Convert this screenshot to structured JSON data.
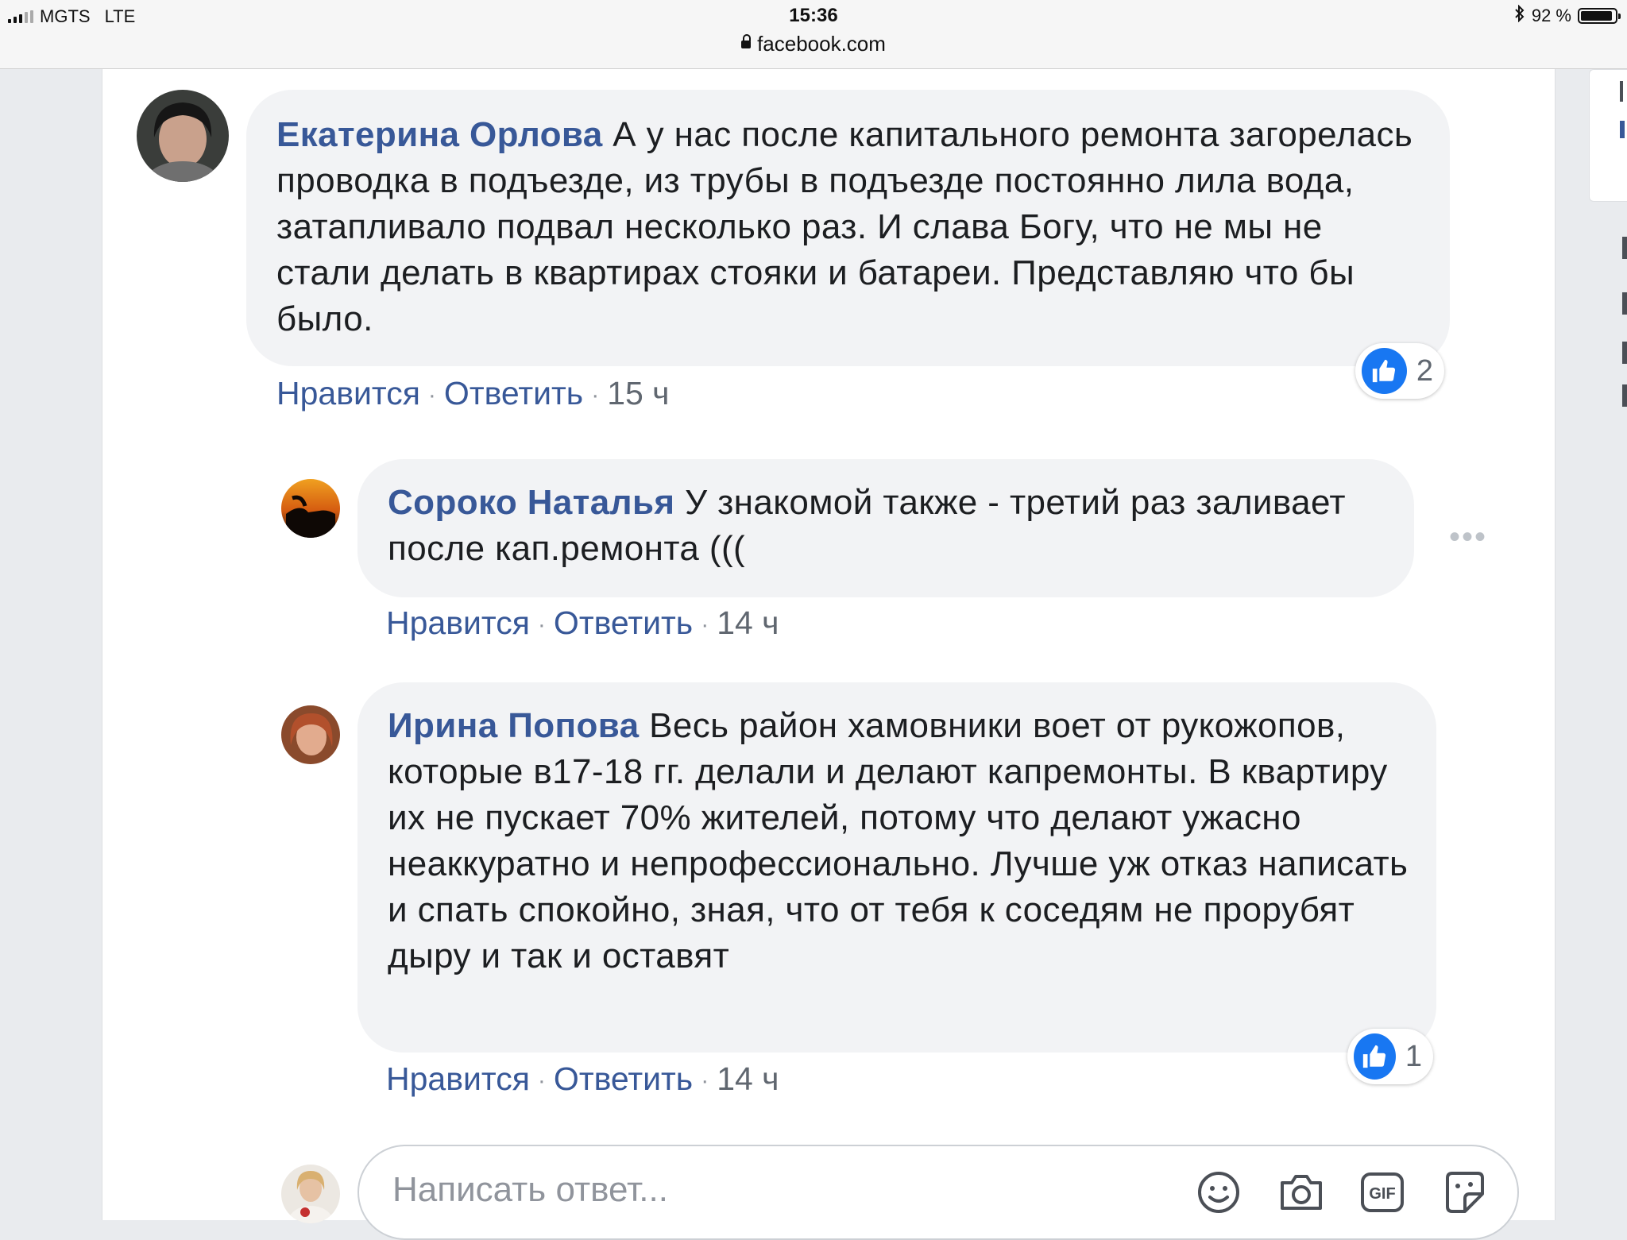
{
  "status_bar": {
    "carrier": "MGTS",
    "network": "LTE",
    "time": "15:36",
    "url": "facebook.com",
    "battery": "92 %",
    "battery_level": 0.92
  },
  "comments": [
    {
      "author": "Екатерина Орлова",
      "text": "А у нас после капитального ремонта загорелась проводка в подъезде, из трубы в подъезде постоянно лила вода, затапливало подвал несколько раз. И слава Богу, что не мы не стали делать в квартирах стояки и батареи. Представляю что бы было.",
      "like_label": "Нравится",
      "reply_label": "Ответить",
      "time": "15 ч",
      "reactions": "2"
    },
    {
      "author": "Сороко Наталья",
      "text": "У знакомой также - третий раз заливает после кап.ремонта (((",
      "like_label": "Нравится",
      "reply_label": "Ответить",
      "time": "14 ч"
    },
    {
      "author": "Ирина Попова",
      "text": "Весь район хамовники воет от рукожопов, которые в17-18 гг. делали и делают капремонты. В квартиру их не пускает 70% жителей, потому что делают ужасно неаккуратно и непрофессионально. Лучше уж отказ написать и спать спокойно, зная, что от тебя к соседям не прорубят дыру и так и оставят",
      "like_label": "Нравится",
      "reply_label": "Ответить",
      "time": "14 ч",
      "reactions": "1"
    }
  ],
  "reply_input": {
    "placeholder": "Написать ответ..."
  },
  "colors": {
    "link": "#385898",
    "bubble": "#f2f3f5",
    "like_blue": "#1877f2"
  },
  "icons": [
    "lock-icon",
    "bluetooth-icon",
    "battery-icon",
    "like-icon",
    "more-options-icon",
    "emoji-icon",
    "camera-icon",
    "gif-icon",
    "sticker-icon"
  ]
}
